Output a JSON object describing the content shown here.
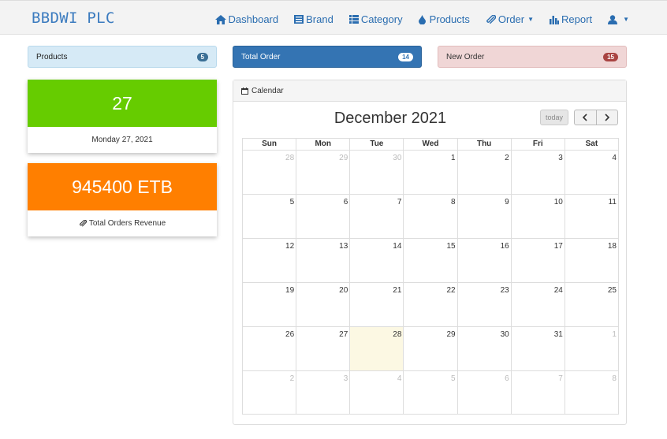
{
  "brand": "BBDWI PLC",
  "nav": [
    {
      "label": "Dashboard",
      "icon": "home-icon"
    },
    {
      "label": "Brand",
      "icon": "list-alt-icon"
    },
    {
      "label": "Category",
      "icon": "th-list-icon"
    },
    {
      "label": "Products",
      "icon": "drop-icon"
    },
    {
      "label": "Order",
      "icon": "paperclip-icon",
      "dropdown": true
    },
    {
      "label": "Report",
      "icon": "bar-chart-icon"
    },
    {
      "label": "",
      "icon": "user-icon",
      "dropdown": true
    }
  ],
  "panels": {
    "products": {
      "label": "Products",
      "count": "5"
    },
    "total_order": {
      "label": "Total Order",
      "count": "14"
    },
    "new_order": {
      "label": "New Order",
      "count": "15"
    }
  },
  "day_card": {
    "value": "27",
    "label": "Monday 27, 2021"
  },
  "revenue_card": {
    "value": "945400 ETB",
    "label": "Total Orders Revenue"
  },
  "calendar": {
    "panel_title": "Calendar",
    "month_title": "December 2021",
    "today_label": "today",
    "weekdays": [
      "Sun",
      "Mon",
      "Tue",
      "Wed",
      "Thu",
      "Fri",
      "Sat"
    ],
    "weeks": [
      [
        "28",
        "29",
        "30",
        "1",
        "2",
        "3",
        "4"
      ],
      [
        "5",
        "6",
        "7",
        "8",
        "9",
        "10",
        "11"
      ],
      [
        "12",
        "13",
        "14",
        "15",
        "16",
        "17",
        "18"
      ],
      [
        "19",
        "20",
        "21",
        "22",
        "23",
        "24",
        "25"
      ],
      [
        "26",
        "27",
        "28",
        "29",
        "30",
        "31",
        "1"
      ],
      [
        "2",
        "3",
        "4",
        "5",
        "6",
        "7",
        "8"
      ]
    ],
    "other_month": [
      [
        0,
        0
      ],
      [
        0,
        1
      ],
      [
        0,
        2
      ],
      [
        4,
        6
      ],
      [
        5,
        0
      ],
      [
        5,
        1
      ],
      [
        5,
        2
      ],
      [
        5,
        3
      ],
      [
        5,
        4
      ],
      [
        5,
        5
      ],
      [
        5,
        6
      ]
    ],
    "today_cell": [
      4,
      2
    ]
  }
}
